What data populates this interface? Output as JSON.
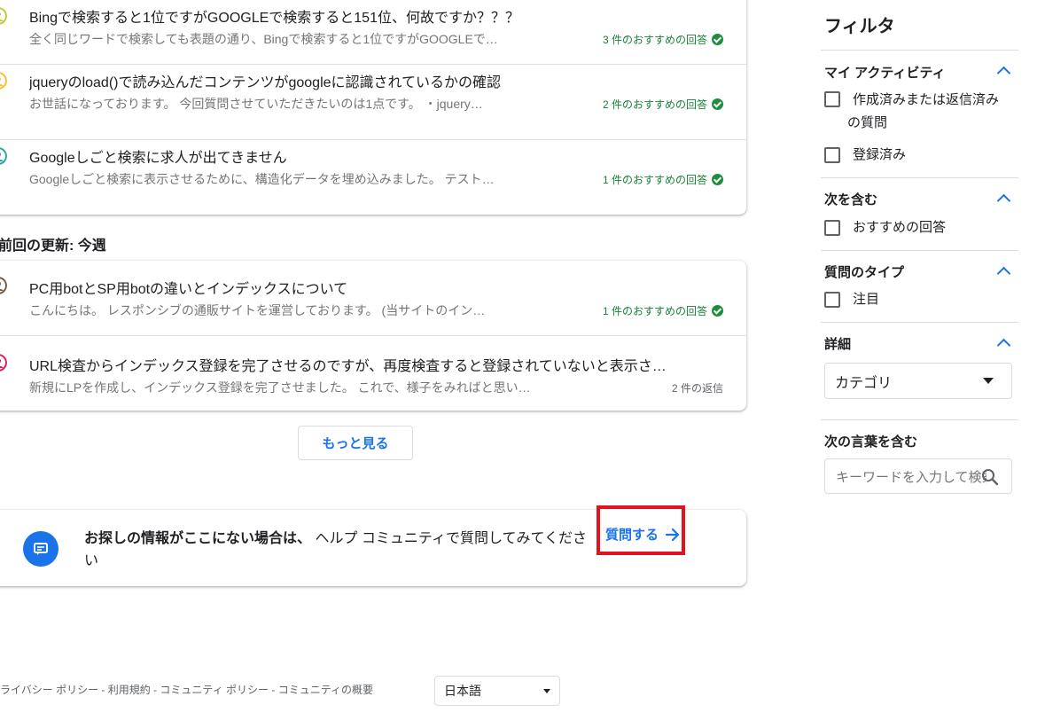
{
  "threads_group1": [
    {
      "title": "Bingで検索すると1位ですがGOOGLEで検索すると151位、何故ですか？？？",
      "snippet": "全く同じワードで検索しても表題の通り、Bingで検索すると1位ですがGOOGLEで…",
      "meta": "3 件のおすすめの回答",
      "avatar_color": "#c0ca33"
    },
    {
      "title": "jqueryのload()で読み込んだコンテンツがgoogleに認識されているかの確認",
      "snippet": "お世話になっております。 今回質問させていただきたいのは1点です。 ・jquery…",
      "meta": "2 件のおすすめの回答",
      "avatar_color": "#fbc02d"
    },
    {
      "title": "Googleしごと検索に求人が出てきません",
      "snippet": "Googleしごと検索に表示させるために、構造化データを埋め込みました。 テスト…",
      "meta": "1 件のおすすめの回答",
      "avatar_color": "#26a69a"
    }
  ],
  "section_label": "前回の更新: 今週",
  "threads_group2": [
    {
      "title": "PC用botとSP用botの違いとインデックスについて",
      "snippet": "こんにちは。 レスポンシブの通販サイトを運営しております。 (当サイトのイン…",
      "meta": "1 件のおすすめの回答",
      "avatar_color": "#795548"
    },
    {
      "title": "URL検査からインデックス登録を完了させるのですが、再度検査すると登録されていないと表示さ…",
      "snippet": "新規にLPを作成し、インデックス登録を完了させました。 これで、様子をみればと思いきや…",
      "meta": "2 件の返信",
      "avatar_color": "#d81b60"
    }
  ],
  "more_button": "もっと見る",
  "help_card": {
    "bold_text": "お探しの情報がここにない場合は、",
    "text": " ヘルプ コミュニティで質問してみてください",
    "ask_label": "質問する"
  },
  "footer": {
    "links": "ライバシー ポリシー - 利用規約 - コミュニティ ポリシー - コミュニティの概要",
    "language": "日本語"
  },
  "sidebar": {
    "title": "フィルタ",
    "my_activity": {
      "heading": "マイ アクティビティ",
      "opt1_line1": "作成済みまたは返信済み",
      "opt1_line2": "の質問",
      "opt2": "登録済み"
    },
    "contains": {
      "heading": "次を含む",
      "opt1": "おすすめの回答"
    },
    "question_type": {
      "heading": "質問のタイプ",
      "opt1": "注目"
    },
    "details": {
      "heading": "詳細",
      "category": "カテゴリ"
    },
    "keyword": {
      "heading": "次の言葉を含む",
      "placeholder": "キーワードを入力して検索"
    }
  }
}
